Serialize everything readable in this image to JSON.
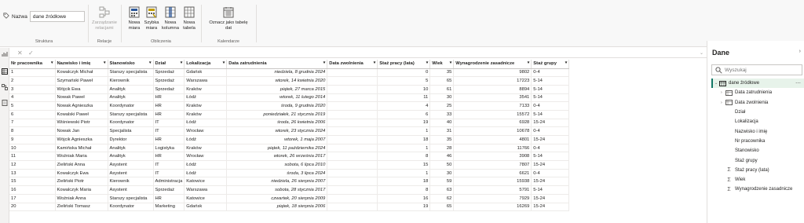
{
  "ribbon": {
    "name_label": "Nazwa",
    "name_value": "dane źródłowe",
    "groups": {
      "struktura": "Struktura",
      "relacje": "Relacje",
      "obliczenia": "Obliczenia",
      "kalendarze": "Kalendarze"
    },
    "buttons": {
      "zarzadzanie": [
        "Zarządzanie",
        "relacjami"
      ],
      "nowa_miara": [
        "Nowa",
        "miara"
      ],
      "szybka_miara": [
        "Szybka",
        "miara"
      ],
      "nowa_kolumna": [
        "Nowa",
        "kolumna"
      ],
      "nowa_tabela": [
        "Nowa",
        "tabela"
      ],
      "oznacz": [
        "Oznacz jako tabelę",
        "dat"
      ]
    }
  },
  "table": {
    "columns": [
      "Nr pracownika",
      "Nazwisko i imię",
      "Stanowisko",
      "Dział",
      "Lokalizacja",
      "Data zatrudnienia",
      "Data zwolnienia",
      "Staż pracy (lata)",
      "Wiek",
      "Wynagrodzenie zasadnicze",
      "Staż grupy"
    ],
    "rows": [
      [
        "1",
        "Kowalczyk Michał",
        "Starszy specjalista",
        "Sprzedaż",
        "Gdańsk",
        "niedziela, 8 grudnia 2024",
        "",
        "0",
        "35",
        "9802",
        "0-4"
      ],
      [
        "2",
        "Szymański Paweł",
        "Kierownik",
        "Sprzedaż",
        "Warszawa",
        "wtorek, 14 kwietnia 2020",
        "",
        "5",
        "65",
        "17223",
        "5-14"
      ],
      [
        "3",
        "Wójcik Ewa",
        "Analityk",
        "Sprzedaż",
        "Kraków",
        "piątek, 27 marca 2015",
        "",
        "10",
        "61",
        "8894",
        "5-14"
      ],
      [
        "4",
        "Nowak Paweł",
        "Analityk",
        "HR",
        "Łódź",
        "wtorek, 11 lutego 2014",
        "",
        "11",
        "30",
        "3541",
        "5-14"
      ],
      [
        "5",
        "Nowak Agnieszka",
        "Koordynator",
        "HR",
        "Kraków",
        "środa, 9 grudnia 2020",
        "",
        "4",
        "25",
        "7133",
        "0-4"
      ],
      [
        "6",
        "Kowalski Paweł",
        "Starszy specjalista",
        "HR",
        "Kraków",
        "poniedziałek, 21 stycznia 2019",
        "",
        "6",
        "33",
        "15572",
        "5-14"
      ],
      [
        "7",
        "Wiśniewski Piotr",
        "Koordynator",
        "IT",
        "Łódź",
        "środa, 26 kwietnia 2006",
        "",
        "19",
        "40",
        "6928",
        "15-24"
      ],
      [
        "8",
        "Nowak Jan",
        "Specjalista",
        "IT",
        "Wrocław",
        "wtorek, 23 stycznia 2024",
        "",
        "1",
        "31",
        "10678",
        "0-4"
      ],
      [
        "9",
        "Wójcik Agnieszka",
        "Dyrektor",
        "HR",
        "Łódź",
        "wtorek, 1 maja 2007",
        "",
        "18",
        "35",
        "4801",
        "15-24"
      ],
      [
        "10",
        "Kamińska Michał",
        "Analityk",
        "Logistyka",
        "Kraków",
        "piątek, 11 października 2024",
        "",
        "1",
        "28",
        "11766",
        "0-4"
      ],
      [
        "11",
        "Woźniak Maria",
        "Analityk",
        "HR",
        "Wrocław",
        "wtorek, 26 września 2017",
        "",
        "8",
        "46",
        "3908",
        "5-14"
      ],
      [
        "12",
        "Zieliński Anna",
        "Asystent",
        "IT",
        "Łódź",
        "sobota, 6 lipca 2010",
        "",
        "15",
        "50",
        "7807",
        "15-24"
      ],
      [
        "13",
        "Kowalczyk Ewa",
        "Asystent",
        "IT",
        "Łódź",
        "środa, 3 lipca 2024",
        "",
        "1",
        "30",
        "6621",
        "0-4"
      ],
      [
        "15",
        "Zieliński Piotr",
        "Kierownik",
        "Administracja",
        "Katowice",
        "niedziela, 26 sierpnia 2007",
        "",
        "18",
        "59",
        "15938",
        "15-24"
      ],
      [
        "16",
        "Kowalczyk Maria",
        "Asystent",
        "Sprzedaż",
        "Warszawa",
        "sobota, 28 stycznia 2017",
        "",
        "8",
        "63",
        "5791",
        "5-14"
      ],
      [
        "17",
        "Woźniak Anna",
        "Starszy specjalista",
        "HR",
        "Katowice",
        "czwartek, 20 sierpnia 2009",
        "",
        "16",
        "62",
        "7929",
        "15-24"
      ],
      [
        "20",
        "Zieliński Tomasz",
        "Koordynator",
        "Marketing",
        "Gdańsk",
        "piątek, 18 sierpnia 2006",
        "",
        "19",
        "65",
        "16269",
        "15-24"
      ]
    ]
  },
  "panel": {
    "title": "Dane",
    "search_placeholder": "Wyszukaj",
    "table_name": "dane źródłowe",
    "fields": [
      {
        "label": "Data zatrudnienia",
        "kind": "table",
        "expand": true
      },
      {
        "label": "Data zwolnienia",
        "kind": "table",
        "expand": true
      },
      {
        "label": "Dział",
        "kind": "none",
        "expand": false
      },
      {
        "label": "Lokalizacja",
        "kind": "none",
        "expand": false
      },
      {
        "label": "Nazwisko i imię",
        "kind": "none",
        "expand": false
      },
      {
        "label": "Nr pracownika",
        "kind": "none",
        "expand": false
      },
      {
        "label": "Stanowisko",
        "kind": "none",
        "expand": false
      },
      {
        "label": "Staż grupy",
        "kind": "none",
        "expand": false
      },
      {
        "label": "Staż pracy (lata)",
        "kind": "sigma",
        "expand": false
      },
      {
        "label": "Wiek",
        "kind": "sigma",
        "expand": false
      },
      {
        "label": "Wynagrodzenie zasadnicze",
        "kind": "sigma",
        "expand": false
      }
    ]
  },
  "colors": {
    "accent": "#117865",
    "selected_bg": "#e7f3ea"
  }
}
